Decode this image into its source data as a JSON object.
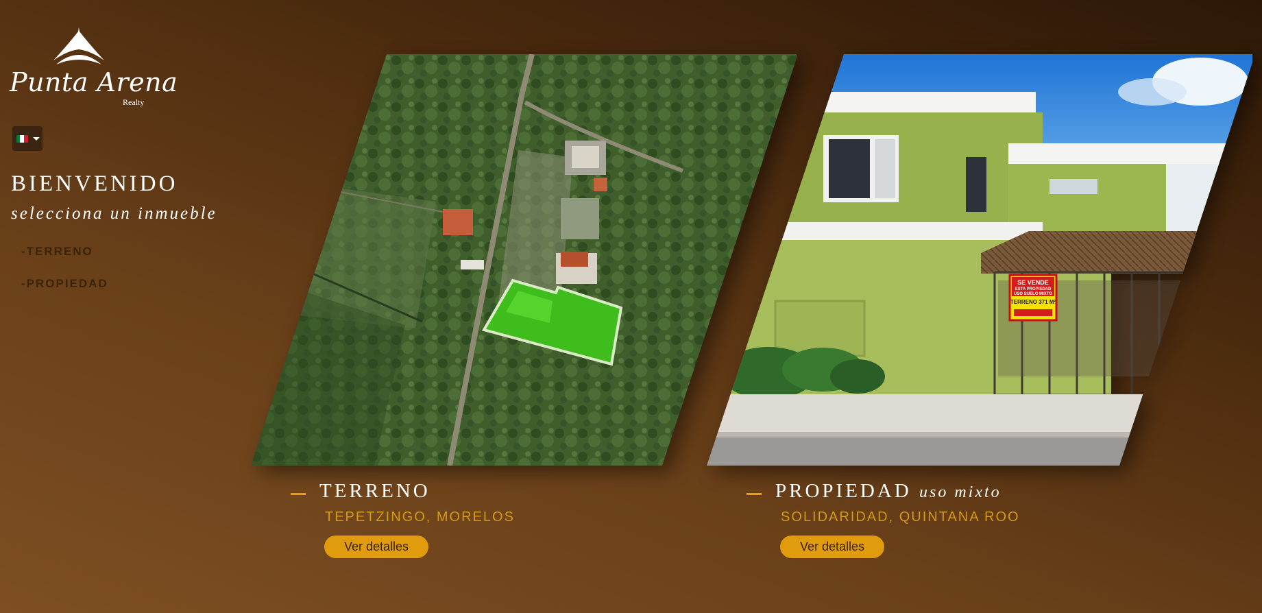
{
  "brand": {
    "name": "Punta Arena",
    "sub": "Realty"
  },
  "language": {
    "flag": "mexico-flag-icon"
  },
  "welcome": {
    "title": "BIENVENIDO",
    "subtitle": "selecciona un inmueble"
  },
  "menu": [
    {
      "label": "-TERRENO"
    },
    {
      "label": "-PROPIEDAD"
    }
  ],
  "cards": [
    {
      "title": "TERRENO",
      "title_em": "",
      "location": "TEPETZINGO, MORELOS",
      "button": "Ver detalles",
      "image": "aerial-lot-photo"
    },
    {
      "title": "PROPIEDAD",
      "title_em": "uso mixto",
      "location": "SOLIDARIDAD, QUINTANA ROO",
      "button": "Ver detalles",
      "image": "building-photo"
    }
  ],
  "sign": {
    "line1": "SE VENDE",
    "line2": "ESTA PROPIEDAD",
    "line3": "USO SUELO MIXTO",
    "line4": "TERRENO 371 M²"
  },
  "colors": {
    "accent": "#e19c0e",
    "location_text": "#d49a14",
    "menu_text": "#3a2309"
  }
}
